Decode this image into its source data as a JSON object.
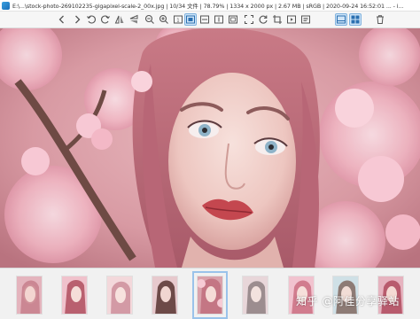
{
  "window": {
    "title": "E:\\...\\stock-photo-269102235-gigapixel-scale-2_00x.jpg | 10/34 文件 | 78.79% | 1334 x 2000 px | 2.67 MB | sRGB | 2020-09-24 16:52:01 ... - i..."
  },
  "toolbar": {
    "buttons": [
      {
        "name": "chevron-left-icon",
        "glyph": "‹"
      },
      {
        "name": "chevron-right-icon",
        "glyph": "›"
      },
      {
        "name": "rotate-left-icon",
        "glyph": "↺"
      },
      {
        "name": "rotate-right-icon",
        "glyph": "↻"
      },
      {
        "name": "flip-horizontal-icon",
        "glyph": "◁"
      },
      {
        "name": "flip-vertical-icon",
        "glyph": "▽"
      },
      {
        "name": "zoom-out-icon",
        "glyph": "⊖"
      },
      {
        "name": "zoom-in-icon",
        "glyph": "⊕"
      },
      {
        "name": "actual-size-icon",
        "glyph": "▢"
      },
      {
        "name": "fit-window-icon",
        "glyph": "▣",
        "active": true
      },
      {
        "name": "fit-width-icon",
        "glyph": "⬚"
      },
      {
        "name": "fit-height-icon",
        "glyph": "▤"
      },
      {
        "name": "auto-fit-icon",
        "glyph": "▦"
      },
      {
        "name": "fullscreen-icon",
        "glyph": "⛶"
      },
      {
        "name": "slideshow-icon",
        "glyph": "▶"
      },
      {
        "name": "refresh-icon",
        "glyph": "⟳"
      },
      {
        "name": "crop-icon",
        "glyph": "⌗"
      },
      {
        "name": "gallery-icon",
        "glyph": "▥",
        "active": true
      },
      {
        "name": "thumbnails-icon",
        "glyph": "▦",
        "active": true
      },
      {
        "name": "delete-icon",
        "glyph": "🗑"
      }
    ]
  },
  "thumbnails": {
    "count": 9,
    "selected_index": 4
  },
  "watermark": "知乎 @阿佳分享驿站",
  "colors": {
    "accent": "#7fb2de",
    "toolbar_bg": "#f6f6f6",
    "strip_bg": "#f1f1f1"
  }
}
